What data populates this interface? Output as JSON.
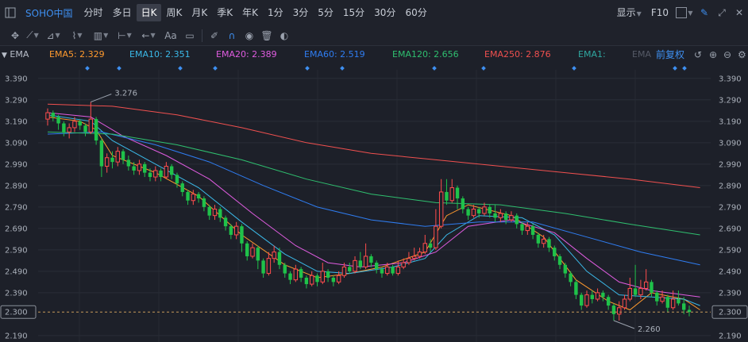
{
  "toolbar": {
    "brand": "SOHO中国",
    "periods": [
      "分时",
      "多日",
      "日K",
      "周K",
      "月K",
      "季K",
      "年K",
      "1分",
      "3分",
      "5分",
      "15分",
      "30分",
      "60分"
    ],
    "active_period": "日K",
    "display_label": "显示",
    "f10_label": "F10",
    "aa_label": "Aa"
  },
  "indicator": {
    "name": "EMA",
    "ema5": "EMA5: 2.329",
    "ema10": "EMA10: 2.351",
    "ema20": "EMA20: 2.389",
    "ema60": "EMA60: 2.519",
    "ema120": "EMA120: 2.656",
    "ema250": "EMA250: 2.876",
    "ema_extra1": "EMA1:",
    "ema_extra2": "EMA",
    "adjust_label": "前复权"
  },
  "colors": {
    "up": "#ff4d4d",
    "down": "#1fc24a",
    "ema5": "#ff9a2e",
    "ema10": "#3bb9e8",
    "ema20": "#e05ce0",
    "ema60": "#2f7df2",
    "ema120": "#2fbf6f",
    "ema250": "#f0504f",
    "brand": "#3e8ff0"
  },
  "chart_data": {
    "type": "candlestick",
    "y_ticks": [
      "3.390",
      "3.290",
      "3.190",
      "3.090",
      "2.990",
      "2.890",
      "2.790",
      "2.690",
      "2.590",
      "2.490",
      "2.390",
      "2.300",
      "2.190"
    ],
    "ylim": [
      2.16,
      3.43
    ],
    "current_price": 2.3,
    "current_price_label": "2.300",
    "high_label": "3.276",
    "low_label": "2.260",
    "candles": [
      [
        3.2,
        3.23,
        3.25,
        3.17
      ],
      [
        3.23,
        3.21,
        3.24,
        3.19
      ],
      [
        3.21,
        3.18,
        3.22,
        3.15
      ],
      [
        3.18,
        3.14,
        3.19,
        3.12
      ],
      [
        3.14,
        3.16,
        3.18,
        3.11
      ],
      [
        3.16,
        3.19,
        3.21,
        3.14
      ],
      [
        3.19,
        3.17,
        3.2,
        3.15
      ],
      [
        3.17,
        3.14,
        3.18,
        3.12
      ],
      [
        3.14,
        3.2,
        3.28,
        3.13
      ],
      [
        3.2,
        3.1,
        3.21,
        3.08
      ],
      [
        3.1,
        2.98,
        3.11,
        2.93
      ],
      [
        2.98,
        3.02,
        3.04,
        2.95
      ],
      [
        3.02,
        3.0,
        3.05,
        2.97
      ],
      [
        3.0,
        3.05,
        3.07,
        2.98
      ],
      [
        3.05,
        3.01,
        3.06,
        2.99
      ],
      [
        3.01,
        2.98,
        3.03,
        2.96
      ],
      [
        2.98,
        2.96,
        3.0,
        2.94
      ],
      [
        2.96,
        2.99,
        3.01,
        2.94
      ],
      [
        2.99,
        2.95,
        3.0,
        2.93
      ],
      [
        2.95,
        2.93,
        2.97,
        2.91
      ],
      [
        2.93,
        2.96,
        2.98,
        2.91
      ],
      [
        2.96,
        2.93,
        2.97,
        2.91
      ],
      [
        2.93,
        2.98,
        3.0,
        2.92
      ],
      [
        2.98,
        2.94,
        2.99,
        2.92
      ],
      [
        2.94,
        2.9,
        2.95,
        2.88
      ],
      [
        2.9,
        2.86,
        2.91,
        2.84
      ],
      [
        2.86,
        2.82,
        2.87,
        2.8
      ],
      [
        2.82,
        2.85,
        2.87,
        2.8
      ],
      [
        2.85,
        2.83,
        2.86,
        2.81
      ],
      [
        2.83,
        2.79,
        2.84,
        2.77
      ],
      [
        2.79,
        2.75,
        2.8,
        2.73
      ],
      [
        2.75,
        2.78,
        2.8,
        2.73
      ],
      [
        2.78,
        2.74,
        2.79,
        2.72
      ],
      [
        2.74,
        2.7,
        2.75,
        2.68
      ],
      [
        2.7,
        2.66,
        2.71,
        2.64
      ],
      [
        2.66,
        2.7,
        2.72,
        2.64
      ],
      [
        2.7,
        2.62,
        2.71,
        2.58
      ],
      [
        2.62,
        2.56,
        2.63,
        2.54
      ],
      [
        2.56,
        2.6,
        2.62,
        2.55
      ],
      [
        2.6,
        2.54,
        2.61,
        2.5
      ],
      [
        2.54,
        2.48,
        2.55,
        2.46
      ],
      [
        2.48,
        2.55,
        2.58,
        2.47
      ],
      [
        2.55,
        2.58,
        2.61,
        2.53
      ],
      [
        2.58,
        2.52,
        2.6,
        2.5
      ],
      [
        2.52,
        2.48,
        2.53,
        2.46
      ],
      [
        2.48,
        2.45,
        2.49,
        2.43
      ],
      [
        2.45,
        2.5,
        2.52,
        2.44
      ],
      [
        2.5,
        2.46,
        2.51,
        2.44
      ],
      [
        2.46,
        2.43,
        2.47,
        2.41
      ],
      [
        2.43,
        2.47,
        2.49,
        2.42
      ],
      [
        2.47,
        2.44,
        2.48,
        2.42
      ],
      [
        2.44,
        2.49,
        2.53,
        2.43
      ],
      [
        2.49,
        2.46,
        2.5,
        2.44
      ],
      [
        2.46,
        2.44,
        2.47,
        2.42
      ],
      [
        2.44,
        2.47,
        2.49,
        2.43
      ],
      [
        2.47,
        2.51,
        2.53,
        2.46
      ],
      [
        2.51,
        2.49,
        2.53,
        2.48
      ],
      [
        2.49,
        2.54,
        2.56,
        2.48
      ],
      [
        2.54,
        2.51,
        2.58,
        2.5
      ],
      [
        2.51,
        2.56,
        2.62,
        2.5
      ],
      [
        2.56,
        2.53,
        2.57,
        2.51
      ],
      [
        2.53,
        2.5,
        2.54,
        2.48
      ],
      [
        2.5,
        2.48,
        2.51,
        2.46
      ],
      [
        2.48,
        2.51,
        2.53,
        2.47
      ],
      [
        2.51,
        2.48,
        2.52,
        2.47
      ],
      [
        2.48,
        2.51,
        2.54,
        2.47
      ],
      [
        2.51,
        2.53,
        2.55,
        2.5
      ],
      [
        2.53,
        2.55,
        2.58,
        2.52
      ],
      [
        2.55,
        2.56,
        2.6,
        2.54
      ],
      [
        2.56,
        2.58,
        2.6,
        2.55
      ],
      [
        2.58,
        2.62,
        2.66,
        2.57
      ],
      [
        2.62,
        2.6,
        2.64,
        2.58
      ],
      [
        2.6,
        2.7,
        2.78,
        2.59
      ],
      [
        2.7,
        2.86,
        2.92,
        2.69
      ],
      [
        2.86,
        2.82,
        2.92,
        2.8
      ],
      [
        2.82,
        2.88,
        2.92,
        2.81
      ],
      [
        2.88,
        2.83,
        2.89,
        2.78
      ],
      [
        2.83,
        2.78,
        2.84,
        2.76
      ],
      [
        2.78,
        2.75,
        2.79,
        2.73
      ],
      [
        2.75,
        2.78,
        2.8,
        2.74
      ],
      [
        2.78,
        2.76,
        2.79,
        2.74
      ],
      [
        2.76,
        2.79,
        2.81,
        2.75
      ],
      [
        2.79,
        2.76,
        2.8,
        2.74
      ],
      [
        2.76,
        2.74,
        2.8,
        2.72
      ],
      [
        2.74,
        2.76,
        2.78,
        2.72
      ],
      [
        2.76,
        2.73,
        2.77,
        2.71
      ],
      [
        2.73,
        2.75,
        2.77,
        2.72
      ],
      [
        2.75,
        2.71,
        2.76,
        2.69
      ],
      [
        2.71,
        2.68,
        2.72,
        2.66
      ],
      [
        2.68,
        2.7,
        2.72,
        2.66
      ],
      [
        2.7,
        2.66,
        2.71,
        2.64
      ],
      [
        2.66,
        2.62,
        2.67,
        2.6
      ],
      [
        2.62,
        2.64,
        2.66,
        2.6
      ],
      [
        2.64,
        2.6,
        2.65,
        2.58
      ],
      [
        2.6,
        2.56,
        2.61,
        2.54
      ],
      [
        2.56,
        2.52,
        2.57,
        2.5
      ],
      [
        2.52,
        2.48,
        2.53,
        2.46
      ],
      [
        2.48,
        2.44,
        2.49,
        2.42
      ],
      [
        2.44,
        2.38,
        2.45,
        2.36
      ],
      [
        2.38,
        2.33,
        2.39,
        2.31
      ],
      [
        2.33,
        2.38,
        2.4,
        2.32
      ],
      [
        2.38,
        2.36,
        2.4,
        2.34
      ],
      [
        2.36,
        2.39,
        2.41,
        2.35
      ],
      [
        2.39,
        2.37,
        2.4,
        2.35
      ],
      [
        2.37,
        2.33,
        2.38,
        2.31
      ],
      [
        2.33,
        2.29,
        2.34,
        2.26
      ],
      [
        2.29,
        2.32,
        2.35,
        2.26
      ],
      [
        2.32,
        2.36,
        2.38,
        2.31
      ],
      [
        2.36,
        2.41,
        2.46,
        2.35
      ],
      [
        2.41,
        2.38,
        2.52,
        2.37
      ],
      [
        2.38,
        2.41,
        2.45,
        2.36
      ],
      [
        2.41,
        2.44,
        2.5,
        2.4
      ],
      [
        2.44,
        2.39,
        2.45,
        2.37
      ],
      [
        2.39,
        2.35,
        2.4,
        2.33
      ],
      [
        2.35,
        2.37,
        2.4,
        2.34
      ],
      [
        2.37,
        2.32,
        2.38,
        2.3
      ],
      [
        2.32,
        2.36,
        2.4,
        2.31
      ],
      [
        2.36,
        2.34,
        2.4,
        2.33
      ],
      [
        2.34,
        2.31,
        2.37,
        2.29
      ],
      [
        2.31,
        2.3,
        2.33,
        2.28
      ]
    ],
    "ema_series": [
      {
        "name": "EMA5",
        "color": "#ff9a2e",
        "values": [
          [
            0,
            3.21
          ],
          [
            6,
            3.19
          ],
          [
            9,
            3.15
          ],
          [
            12,
            3.03
          ],
          [
            20,
            2.95
          ],
          [
            28,
            2.84
          ],
          [
            36,
            2.66
          ],
          [
            44,
            2.52
          ],
          [
            50,
            2.46
          ],
          [
            56,
            2.48
          ],
          [
            62,
            2.51
          ],
          [
            70,
            2.58
          ],
          [
            74,
            2.75
          ],
          [
            78,
            2.8
          ],
          [
            86,
            2.75
          ],
          [
            92,
            2.65
          ],
          [
            98,
            2.45
          ],
          [
            104,
            2.35
          ],
          [
            108,
            2.31
          ],
          [
            112,
            2.39
          ],
          [
            118,
            2.36
          ],
          [
            121,
            2.31
          ]
        ]
      },
      {
        "name": "EMA10",
        "color": "#3bb9e8",
        "values": [
          [
            0,
            3.22
          ],
          [
            8,
            3.19
          ],
          [
            12,
            3.1
          ],
          [
            20,
            2.99
          ],
          [
            28,
            2.88
          ],
          [
            36,
            2.72
          ],
          [
            44,
            2.57
          ],
          [
            50,
            2.49
          ],
          [
            56,
            2.48
          ],
          [
            64,
            2.51
          ],
          [
            70,
            2.55
          ],
          [
            74,
            2.66
          ],
          [
            80,
            2.75
          ],
          [
            88,
            2.74
          ],
          [
            94,
            2.66
          ],
          [
            100,
            2.49
          ],
          [
            106,
            2.38
          ],
          [
            112,
            2.37
          ],
          [
            118,
            2.36
          ],
          [
            121,
            2.33
          ]
        ]
      },
      {
        "name": "EMA20",
        "color": "#e05ce0",
        "values": [
          [
            0,
            3.23
          ],
          [
            8,
            3.21
          ],
          [
            14,
            3.12
          ],
          [
            22,
            3.03
          ],
          [
            30,
            2.92
          ],
          [
            38,
            2.76
          ],
          [
            46,
            2.61
          ],
          [
            52,
            2.53
          ],
          [
            58,
            2.51
          ],
          [
            66,
            2.53
          ],
          [
            72,
            2.58
          ],
          [
            78,
            2.7
          ],
          [
            86,
            2.73
          ],
          [
            94,
            2.67
          ],
          [
            100,
            2.55
          ],
          [
            106,
            2.44
          ],
          [
            112,
            2.4
          ],
          [
            121,
            2.37
          ]
        ]
      },
      {
        "name": "EMA60",
        "color": "#2f7df2",
        "values": [
          [
            0,
            3.13
          ],
          [
            10,
            3.14
          ],
          [
            20,
            3.08
          ],
          [
            30,
            3.0
          ],
          [
            40,
            2.89
          ],
          [
            50,
            2.79
          ],
          [
            60,
            2.73
          ],
          [
            70,
            2.7
          ],
          [
            80,
            2.72
          ],
          [
            90,
            2.72
          ],
          [
            100,
            2.65
          ],
          [
            110,
            2.58
          ],
          [
            121,
            2.52
          ]
        ]
      },
      {
        "name": "EMA120",
        "color": "#2fbf6f",
        "values": [
          [
            0,
            3.14
          ],
          [
            12,
            3.13
          ],
          [
            24,
            3.08
          ],
          [
            36,
            3.01
          ],
          [
            48,
            2.92
          ],
          [
            60,
            2.85
          ],
          [
            72,
            2.81
          ],
          [
            84,
            2.8
          ],
          [
            96,
            2.76
          ],
          [
            108,
            2.71
          ],
          [
            121,
            2.66
          ]
        ]
      },
      {
        "name": "EMA250",
        "color": "#f0504f",
        "values": [
          [
            0,
            3.27
          ],
          [
            12,
            3.26
          ],
          [
            24,
            3.22
          ],
          [
            36,
            3.16
          ],
          [
            48,
            3.09
          ],
          [
            60,
            3.04
          ],
          [
            72,
            3.01
          ],
          [
            84,
            2.98
          ],
          [
            96,
            2.95
          ],
          [
            108,
            2.92
          ],
          [
            121,
            2.88
          ]
        ]
      }
    ]
  }
}
